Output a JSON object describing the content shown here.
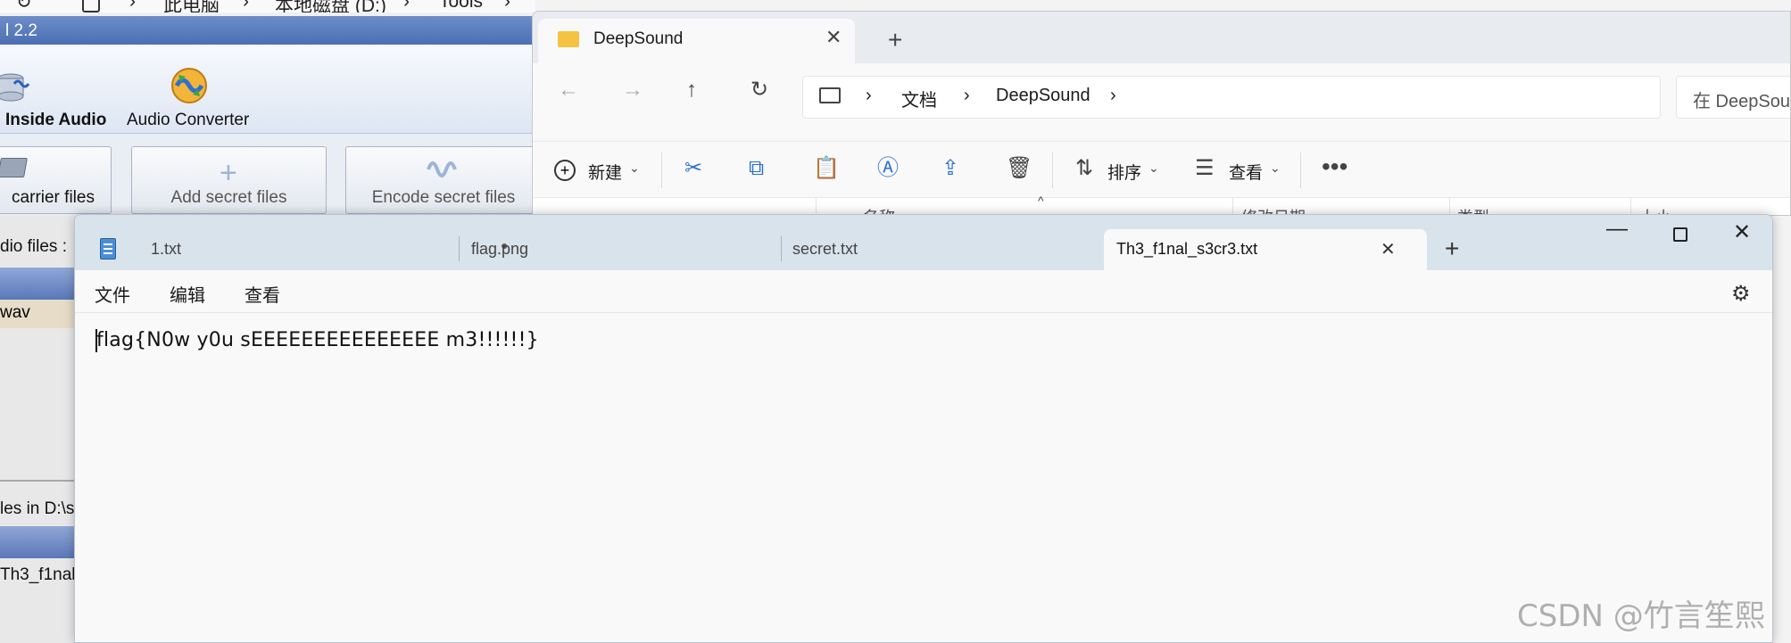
{
  "back_explorer": {
    "breadcrumb": [
      "此电脑",
      "本地磁盘 (D:)",
      "Tools"
    ],
    "separator": ">"
  },
  "deepsound": {
    "title": "l 2.2",
    "ribbon": {
      "inside_audio": "Inside Audio",
      "audio_converter": "Audio Converter"
    },
    "toolbar": {
      "carrier_files": "carrier files",
      "add_secret_files": "Add secret files",
      "encode_secret_files": "Encode secret files"
    },
    "audio_files_label": "dio files :",
    "audio_file_item": "wav",
    "secret_files_label": "les in D:\\s",
    "secret_file_item": "Th3_f1nal_"
  },
  "explorer": {
    "tab_title": "DeepSound",
    "breadcrumb": [
      "文档",
      "DeepSound"
    ],
    "search_placeholder": "在 DeepSou",
    "commands": {
      "new": "新建",
      "sort": "排序",
      "view": "查看"
    },
    "columns": [
      "名称",
      "修改日期",
      "类型",
      "大小"
    ]
  },
  "notepad": {
    "tabs": [
      {
        "name": "1.txt",
        "unsaved": true
      },
      {
        "name": "flag.png",
        "unsaved": false
      },
      {
        "name": "secret.txt",
        "unsaved": false
      },
      {
        "name": "Th3_f1nal_s3cr3.txt",
        "unsaved": false,
        "active": true
      }
    ],
    "unsaved_dot": "●",
    "menu": [
      "文件",
      "编辑",
      "查看"
    ],
    "content": "flag{N0w y0u sEEEEEEEEEEEEEEE m3!!!!!!}"
  },
  "watermark": "CSDN @竹言笙熙"
}
